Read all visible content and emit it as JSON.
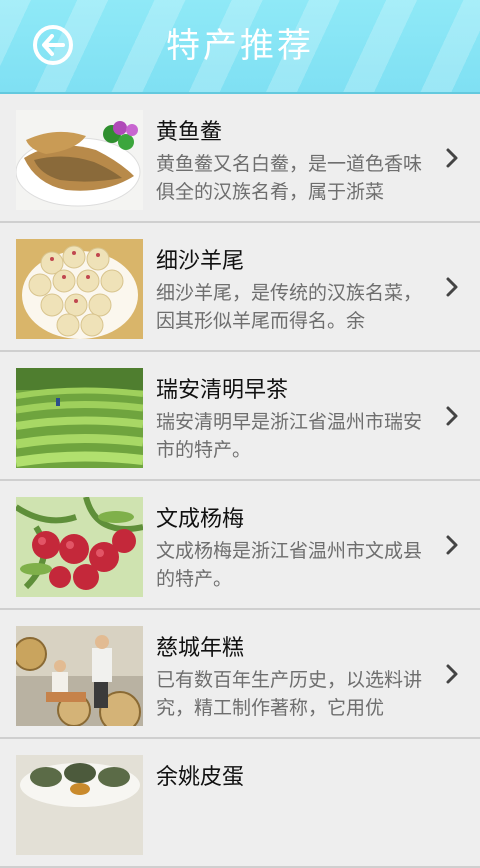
{
  "header": {
    "title": "特产推荐",
    "back_icon": "back-arrow-icon",
    "colors": {
      "bar": "#8fe9f7",
      "text": "#ffffff"
    }
  },
  "items": [
    {
      "name": "黄鱼鲞",
      "desc": "黄鱼鲞又名白鲞，是一道色香味俱全的汉族名肴，属于浙菜",
      "image": "dried-yellow-croaker-image"
    },
    {
      "name": "细沙羊尾",
      "desc": "细沙羊尾，是传统的汉族名菜，因其形似羊尾而得名。余",
      "image": "sweet-bean-paste-balls-image"
    },
    {
      "name": "瑞安清明早茶",
      "desc": "瑞安清明早是浙江省温州市瑞安市的特产。",
      "image": "tea-plantation-image"
    },
    {
      "name": "文成杨梅",
      "desc": "文成杨梅是浙江省温州市文成县的特产。",
      "image": "bayberry-image"
    },
    {
      "name": "慈城年糕",
      "desc": "已有数百年生产历史，以选料讲究，精工制作著称，它用优",
      "image": "rice-cake-making-image"
    },
    {
      "name": "余姚皮蛋",
      "desc": "",
      "image": "preserved-egg-image"
    }
  ]
}
